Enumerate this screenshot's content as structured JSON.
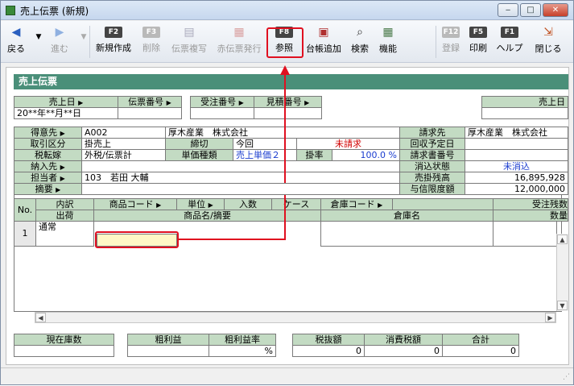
{
  "window": {
    "title": "売上伝票 (新規)",
    "min": "‒",
    "max": "□",
    "close": "✕"
  },
  "toolbar": [
    {
      "key": "",
      "icon": "back-icon",
      "label": "戻る"
    },
    {
      "key": "",
      "icon": "forward-icon",
      "label": "進む"
    },
    {
      "key": "F2",
      "label": "新規作成"
    },
    {
      "key": "F3",
      "label": "削除"
    },
    {
      "key": "",
      "icon": "copy-icon",
      "label": "伝票複写"
    },
    {
      "key": "",
      "icon": "red-slip-icon",
      "label": "赤伝票発行"
    },
    {
      "key": "F8",
      "label": "参照"
    },
    {
      "key": "",
      "icon": "ledger-add-icon",
      "label": "台帳追加"
    },
    {
      "key": "",
      "icon": "search-icon",
      "label": "検索"
    },
    {
      "key": "",
      "icon": "function-icon",
      "label": "機能"
    },
    {
      "key": "F12",
      "label": "登録"
    },
    {
      "key": "F5",
      "label": "印刷"
    },
    {
      "key": "F1",
      "label": "ヘルプ"
    },
    {
      "key": "",
      "icon": "close-app-icon",
      "label": "閉じる"
    }
  ],
  "banner": "売上伝票",
  "header": {
    "sales_date": "売上日",
    "slip_no": "伝票番号",
    "order_no": "受注番号",
    "estimate_no": "見積番号",
    "sales_date2": "売上日",
    "date_value": "20**年**月**日"
  },
  "customer": {
    "label": "得意先",
    "code": "A002",
    "name": "厚木産業　株式会社",
    "billing_label": "請求先",
    "billing_name": "厚木産業　株式会社"
  },
  "row2": {
    "label": "取引区分",
    "value": "掛売上",
    "close_label": "締切",
    "close_value": "今回",
    "status": "未請求",
    "collect_label": "回収予定日"
  },
  "row3": {
    "label": "税転嫁",
    "value": "外税/伝票計",
    "price_label": "単価種類",
    "price_value": "売上単価２",
    "rate_label": "掛率",
    "rate_value": "100.0 %",
    "bill_no_label": "請求書番号"
  },
  "row4": {
    "label": "納入先",
    "clear_label": "消込状態",
    "clear_value": "未消込"
  },
  "row5": {
    "label": "担当者",
    "value": "103　若田 大輔",
    "balance_label": "売掛残高",
    "balance_value": "16,895,928"
  },
  "row6": {
    "label": "摘要",
    "credit_label": "与信限度額",
    "credit_value": "12,000,000"
  },
  "grid": {
    "no": "No.",
    "h1": [
      "内訳",
      "商品コード",
      "単位",
      "入数",
      "ケース",
      "倉庫コード",
      "受注残数"
    ],
    "h2": [
      "出荷",
      "商品名/摘要",
      "倉庫名",
      "数量"
    ],
    "row1_no": "1",
    "row1_type": "通常"
  },
  "footer": {
    "stock_label": "現在庫数",
    "profit_label": "粗利益",
    "profit_rate_label": "粗利益率",
    "profit_rate_unit": "%",
    "net_label": "税抜額",
    "tax_label": "消費税額",
    "total_label": "合計",
    "net_value": "0",
    "tax_value": "0",
    "total_value": "0"
  }
}
